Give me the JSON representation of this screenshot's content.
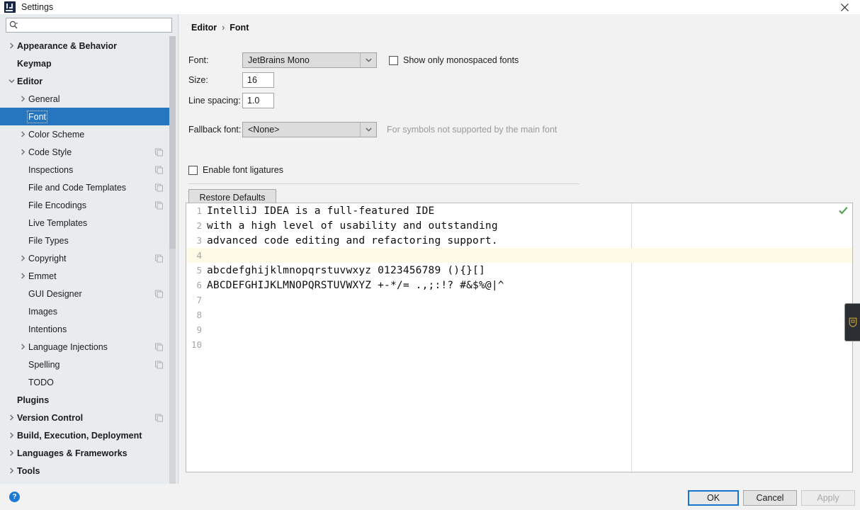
{
  "window": {
    "title": "Settings",
    "app_icon": "intellij-idea-icon",
    "close_icon": "close-icon"
  },
  "search": {
    "placeholder": "",
    "value": "",
    "icon": "search-icon"
  },
  "sidebar": {
    "items": [
      {
        "label": "Appearance & Behavior",
        "level": 0,
        "bold": true,
        "arrow": "chevron-right",
        "copy": false,
        "selected": false
      },
      {
        "label": "Keymap",
        "level": 0,
        "bold": true,
        "arrow": "none",
        "copy": false,
        "selected": false
      },
      {
        "label": "Editor",
        "level": 0,
        "bold": true,
        "arrow": "chevron-down",
        "copy": false,
        "selected": false
      },
      {
        "label": "General",
        "level": 1,
        "bold": false,
        "arrow": "chevron-right",
        "copy": false,
        "selected": false
      },
      {
        "label": "Font",
        "level": 1,
        "bold": false,
        "arrow": "none",
        "copy": false,
        "selected": true
      },
      {
        "label": "Color Scheme",
        "level": 1,
        "bold": false,
        "arrow": "chevron-right",
        "copy": false,
        "selected": false
      },
      {
        "label": "Code Style",
        "level": 1,
        "bold": false,
        "arrow": "chevron-right",
        "copy": true,
        "selected": false
      },
      {
        "label": "Inspections",
        "level": 1,
        "bold": false,
        "arrow": "none",
        "copy": true,
        "selected": false
      },
      {
        "label": "File and Code Templates",
        "level": 1,
        "bold": false,
        "arrow": "none",
        "copy": true,
        "selected": false
      },
      {
        "label": "File Encodings",
        "level": 1,
        "bold": false,
        "arrow": "none",
        "copy": true,
        "selected": false
      },
      {
        "label": "Live Templates",
        "level": 1,
        "bold": false,
        "arrow": "none",
        "copy": false,
        "selected": false
      },
      {
        "label": "File Types",
        "level": 1,
        "bold": false,
        "arrow": "none",
        "copy": false,
        "selected": false
      },
      {
        "label": "Copyright",
        "level": 1,
        "bold": false,
        "arrow": "chevron-right",
        "copy": true,
        "selected": false
      },
      {
        "label": "Emmet",
        "level": 1,
        "bold": false,
        "arrow": "chevron-right",
        "copy": false,
        "selected": false
      },
      {
        "label": "GUI Designer",
        "level": 1,
        "bold": false,
        "arrow": "none",
        "copy": true,
        "selected": false
      },
      {
        "label": "Images",
        "level": 1,
        "bold": false,
        "arrow": "none",
        "copy": false,
        "selected": false
      },
      {
        "label": "Intentions",
        "level": 1,
        "bold": false,
        "arrow": "none",
        "copy": false,
        "selected": false
      },
      {
        "label": "Language Injections",
        "level": 1,
        "bold": false,
        "arrow": "chevron-right",
        "copy": true,
        "selected": false
      },
      {
        "label": "Spelling",
        "level": 1,
        "bold": false,
        "arrow": "none",
        "copy": true,
        "selected": false
      },
      {
        "label": "TODO",
        "level": 1,
        "bold": false,
        "arrow": "none",
        "copy": false,
        "selected": false
      },
      {
        "label": "Plugins",
        "level": 0,
        "bold": true,
        "arrow": "none",
        "copy": false,
        "selected": false
      },
      {
        "label": "Version Control",
        "level": 0,
        "bold": true,
        "arrow": "chevron-right",
        "copy": true,
        "selected": false
      },
      {
        "label": "Build, Execution, Deployment",
        "level": 0,
        "bold": true,
        "arrow": "chevron-right",
        "copy": false,
        "selected": false
      },
      {
        "label": "Languages & Frameworks",
        "level": 0,
        "bold": true,
        "arrow": "chevron-right",
        "copy": false,
        "selected": false
      },
      {
        "label": "Tools",
        "level": 0,
        "bold": true,
        "arrow": "chevron-right",
        "copy": false,
        "selected": false
      }
    ]
  },
  "breadcrumb": {
    "parent": "Editor",
    "separator": "›",
    "current": "Font"
  },
  "form": {
    "font_label": "Font:",
    "font_value": "JetBrains Mono",
    "show_monospaced_label": "Show only monospaced fonts",
    "show_monospaced_checked": false,
    "size_label": "Size:",
    "size_value": "16",
    "line_spacing_label": "Line spacing:",
    "line_spacing_value": "1.0",
    "fallback_label": "Fallback font:",
    "fallback_value": "<None>",
    "fallback_hint": "For symbols not supported by the main font",
    "ligatures_label": "Enable font ligatures",
    "ligatures_checked": false,
    "restore_defaults_label": "Restore Defaults"
  },
  "preview": {
    "caret_line": 4,
    "lines": [
      {
        "no": "1",
        "text": "IntelliJ IDEA is a full-featured IDE"
      },
      {
        "no": "2",
        "text": "with a high level of usability and outstanding"
      },
      {
        "no": "3",
        "text": "advanced code editing and refactoring support."
      },
      {
        "no": "4",
        "text": ""
      },
      {
        "no": "5",
        "text": "abcdefghijklmnopqrstuvwxyz 0123456789 (){}[]"
      },
      {
        "no": "6",
        "text": "ABCDEFGHIJKLMNOPQRSTUVWXYZ +-*/= .,;:!? #&$%@|^"
      },
      {
        "no": "7",
        "text": ""
      },
      {
        "no": "8",
        "text": ""
      },
      {
        "no": "9",
        "text": ""
      },
      {
        "no": "10",
        "text": ""
      }
    ],
    "inspection_icon": "inspection-ok-check-icon"
  },
  "footer": {
    "help_icon": "?",
    "ok_label": "OK",
    "cancel_label": "Cancel",
    "apply_label": "Apply",
    "apply_enabled": false
  },
  "colors": {
    "selection_blue": "#2675bf",
    "focus_blue": "#1675d1",
    "caret_line_yellow": "#fffae6",
    "sidebar_bg": "#e8ecef",
    "panel_bg": "#f2f2f2"
  }
}
